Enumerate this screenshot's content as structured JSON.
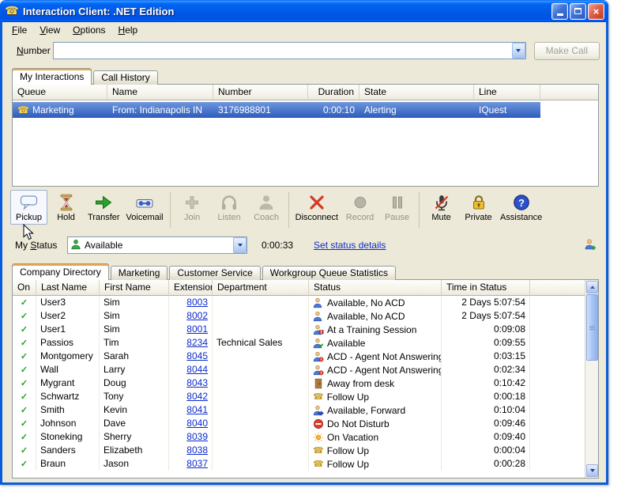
{
  "window": {
    "title": "Interaction Client: .NET Edition"
  },
  "colors": {
    "titlebar": "#0054e3",
    "selection_top": "#6f96dc",
    "selection_bottom": "#2c5cbd",
    "link": "#0b2bcb",
    "background": "#ece9d8"
  },
  "menu": {
    "items": [
      {
        "label": "File",
        "underline": 0
      },
      {
        "label": "View",
        "underline": 0
      },
      {
        "label": "Options",
        "underline": 0
      },
      {
        "label": "Help",
        "underline": 0
      }
    ]
  },
  "dial": {
    "label": "Number",
    "underline": 0,
    "value": "",
    "make_call_label": "Make Call",
    "make_call_enabled": false
  },
  "interaction_tabs": [
    {
      "label": "My Interactions",
      "active": true
    },
    {
      "label": "Call History",
      "active": false
    }
  ],
  "queue_table": {
    "headers": [
      "Queue",
      "Name",
      "Number",
      "Duration",
      "State",
      "Line"
    ],
    "rows": [
      {
        "icon": "call",
        "queue": "Marketing",
        "name": "From: Indianapolis IN",
        "number": "3176988801",
        "duration": "0:00:10",
        "state": "Alerting",
        "line": "IQuest",
        "selected": true
      }
    ]
  },
  "toolbar": {
    "buttons": [
      {
        "label": "Pickup",
        "icon": "pickup",
        "enabled": true,
        "hover": true,
        "sep_after": false
      },
      {
        "label": "Hold",
        "icon": "hold",
        "enabled": true,
        "sep_after": false
      },
      {
        "label": "Transfer",
        "icon": "transfer",
        "enabled": true,
        "sep_after": false
      },
      {
        "label": "Voicemail",
        "icon": "voicemail",
        "enabled": true,
        "sep_after": true
      },
      {
        "label": "Join",
        "icon": "join",
        "enabled": false,
        "sep_after": false
      },
      {
        "label": "Listen",
        "icon": "listen",
        "enabled": false,
        "sep_after": false
      },
      {
        "label": "Coach",
        "icon": "coach",
        "enabled": false,
        "sep_after": true
      },
      {
        "label": "Disconnect",
        "icon": "disconnect",
        "enabled": true,
        "sep_after": false
      },
      {
        "label": "Record",
        "icon": "record",
        "enabled": false,
        "sep_after": false
      },
      {
        "label": "Pause",
        "icon": "pause",
        "enabled": false,
        "sep_after": true
      },
      {
        "label": "Mute",
        "icon": "mute",
        "enabled": true,
        "sep_after": false
      },
      {
        "label": "Private",
        "icon": "private",
        "enabled": true,
        "sep_after": false
      },
      {
        "label": "Assistance",
        "icon": "assistance",
        "enabled": true,
        "sep_after": false
      }
    ]
  },
  "status_bar": {
    "label": "My Status",
    "underline": 3,
    "value": "Available",
    "value_icon": "available-person",
    "timer": "0:00:33",
    "link": "Set status details"
  },
  "directory_tabs": [
    {
      "label": "Company Directory",
      "active": true
    },
    {
      "label": "Marketing",
      "active": false
    },
    {
      "label": "Customer Service",
      "active": false
    },
    {
      "label": "Workgroup Queue Statistics",
      "active": false
    }
  ],
  "directory": {
    "headers": [
      "On",
      "Last Name",
      "First Name",
      "Extension",
      "Department",
      "Status",
      "Time in Status"
    ],
    "rows": [
      {
        "on": true,
        "last": "User3",
        "first": "Sim",
        "ext": "8003",
        "dept": "",
        "status": "Available, No ACD",
        "icon": "user-no-acd",
        "time": "2 Days 5:07:54"
      },
      {
        "on": true,
        "last": "User2",
        "first": "Sim",
        "ext": "8002",
        "dept": "",
        "status": "Available, No ACD",
        "icon": "user-no-acd",
        "time": "2 Days 5:07:54"
      },
      {
        "on": true,
        "last": "User1",
        "first": "Sim",
        "ext": "8001",
        "dept": "",
        "status": "At a Training Session",
        "icon": "training",
        "time": "0:09:08"
      },
      {
        "on": true,
        "last": "Passios",
        "first": "Tim",
        "ext": "8234",
        "dept": "Technical Sales",
        "status": "Available",
        "icon": "available-check",
        "time": "0:09:55"
      },
      {
        "on": true,
        "last": "Montgomery",
        "first": "Sarah",
        "ext": "8045",
        "dept": "",
        "status": "ACD - Agent Not Answering",
        "icon": "acd-alert",
        "time": "0:03:15"
      },
      {
        "on": true,
        "last": "Wall",
        "first": "Larry",
        "ext": "8044",
        "dept": "",
        "status": "ACD - Agent Not Answering",
        "icon": "acd-alert",
        "time": "0:02:34"
      },
      {
        "on": true,
        "last": "Mygrant",
        "first": "Doug",
        "ext": "8043",
        "dept": "",
        "status": "Away from desk",
        "icon": "away-desk",
        "time": "0:10:42"
      },
      {
        "on": true,
        "last": "Schwartz",
        "first": "Tony",
        "ext": "8042",
        "dept": "",
        "status": "Follow Up",
        "icon": "follow-up",
        "time": "0:00:18"
      },
      {
        "on": true,
        "last": "Smith",
        "first": "Kevin",
        "ext": "8041",
        "dept": "",
        "status": "Available, Forward",
        "icon": "forward",
        "time": "0:10:04"
      },
      {
        "on": true,
        "last": "Johnson",
        "first": "Dave",
        "ext": "8040",
        "dept": "",
        "status": "Do Not Disturb",
        "icon": "dnd",
        "time": "0:09:46"
      },
      {
        "on": true,
        "last": "Stoneking",
        "first": "Sherry",
        "ext": "8039",
        "dept": "",
        "status": "On Vacation",
        "icon": "vacation",
        "time": "0:09:40"
      },
      {
        "on": true,
        "last": "Sanders",
        "first": "Elizabeth",
        "ext": "8038",
        "dept": "",
        "status": "Follow Up",
        "icon": "follow-up",
        "time": "0:00:04"
      },
      {
        "on": true,
        "last": "Braun",
        "first": "Jason",
        "ext": "8037",
        "dept": "",
        "status": "Follow Up",
        "icon": "follow-up",
        "time": "0:00:28"
      }
    ]
  }
}
